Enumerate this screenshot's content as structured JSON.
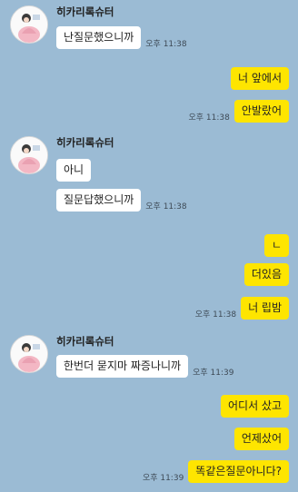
{
  "sender_name": "히카리록슈터",
  "blocks": [
    {
      "type": "in",
      "messages": [
        {
          "text": "난질문했으니까",
          "time": "오후 11:38"
        }
      ]
    },
    {
      "type": "out",
      "messages": [
        {
          "text": "너 앞에서",
          "time": ""
        },
        {
          "text": "안발랐어",
          "time": "오후 11:38"
        }
      ]
    },
    {
      "type": "in",
      "messages": [
        {
          "text": "아니",
          "time": ""
        },
        {
          "text": "질문답했으니까",
          "time": "오후 11:38"
        }
      ]
    },
    {
      "type": "out",
      "messages": [
        {
          "text": "ㄴ",
          "time": ""
        },
        {
          "text": "더있음",
          "time": ""
        },
        {
          "text": "너 립밤",
          "time": "오후 11:38"
        }
      ]
    },
    {
      "type": "in",
      "messages": [
        {
          "text": "한번더 묻지마 짜증나니까",
          "time": "오후 11:39"
        }
      ]
    },
    {
      "type": "out",
      "messages": [
        {
          "text": "어디서 샀고",
          "time": ""
        },
        {
          "text": "언제샀어",
          "time": ""
        },
        {
          "text": "똑같은질문아니다?",
          "time": "오후 11:39"
        }
      ]
    }
  ],
  "colors": {
    "background": "#9bbbd4",
    "incoming_bubble": "#ffffff",
    "outgoing_bubble": "#fee500"
  }
}
